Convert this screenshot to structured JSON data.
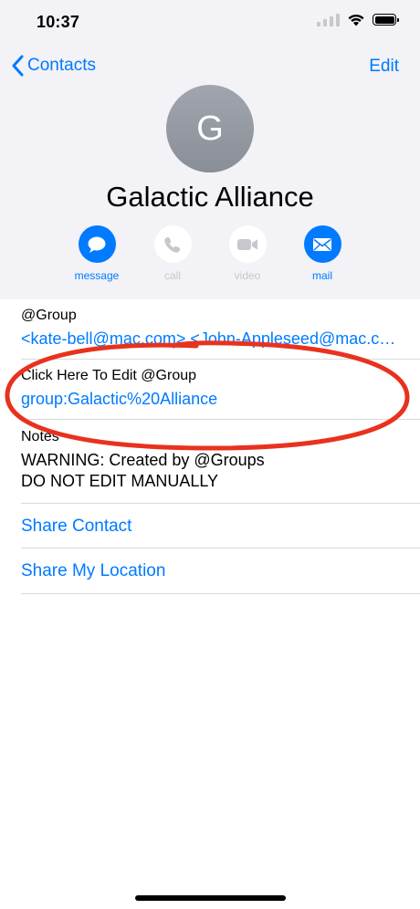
{
  "status_bar": {
    "time": "10:37"
  },
  "nav": {
    "back_label": "Contacts",
    "edit_label": "Edit"
  },
  "contact": {
    "initial": "G",
    "name": "Galactic Alliance"
  },
  "actions": [
    {
      "label": "message",
      "icon": "message-icon",
      "enabled": true
    },
    {
      "label": "call",
      "icon": "phone-icon",
      "enabled": false
    },
    {
      "label": "video",
      "icon": "video-icon",
      "enabled": false
    },
    {
      "label": "mail",
      "icon": "mail-icon",
      "enabled": true
    }
  ],
  "fields": [
    {
      "label": "@Group",
      "value": "<kate-bell@mac.com>,<John-Appleseed@mac.com>"
    },
    {
      "label": "Click Here To Edit @Group",
      "value": "group:Galactic%20Alliance"
    }
  ],
  "notes": {
    "label": "Notes",
    "line1": "WARNING: Created by @Groups",
    "line2": "DO NOT EDIT MANUALLY"
  },
  "links": {
    "share_contact": "Share Contact",
    "share_location": "Share My Location"
  },
  "colors": {
    "accent": "#007aff",
    "annotation": "#e8321e",
    "header_bg": "#f2f2f7",
    "avatar": "#8e929a"
  }
}
